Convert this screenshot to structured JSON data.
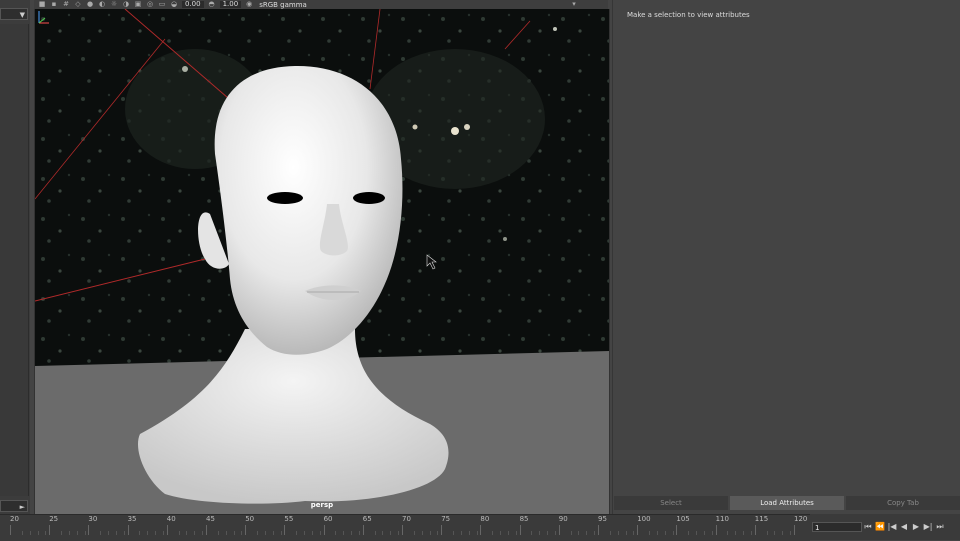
{
  "toolbar": {
    "exposure_value": "0.00",
    "gamma_value": "1.00",
    "color_space": "sRGB gamma"
  },
  "viewport": {
    "camera_label": "persp"
  },
  "attribute_editor": {
    "message": "Make a selection to view attributes",
    "buttons": [
      "Select",
      "Load Attributes",
      "Copy Tab"
    ]
  },
  "timeline": {
    "ticks": [
      "20",
      "25",
      "30",
      "35",
      "40",
      "45",
      "50",
      "55",
      "60",
      "65",
      "70",
      "75",
      "80",
      "85",
      "90",
      "95",
      "100",
      "105",
      "110",
      "115",
      "120"
    ]
  },
  "transport": {
    "current_frame": "1"
  },
  "colors": {
    "panel_bg": "#444444",
    "viewport_bg": "#0d1010",
    "ground": "#6b6b6b",
    "grid_line": "#b02a2a"
  }
}
